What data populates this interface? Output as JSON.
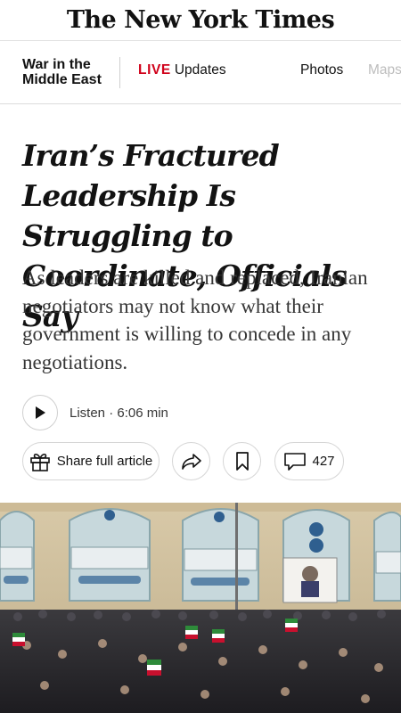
{
  "masthead": {
    "logo": "The New York Times"
  },
  "section_bar": {
    "section_title": "War in the Middle East",
    "live_label": "LIVE",
    "live_text": "Updates",
    "nav": [
      "Photos",
      "Maps"
    ]
  },
  "article": {
    "headline": "Iran’s Fractured Leadership Is Struggling to Coordinate, Officials Say",
    "summary": "As leaders are killed and replaced, Iranian negotiators may not know what their government is willing to concede in any negotiations."
  },
  "audio": {
    "listen_text": "Listen · 6:06 min",
    "play_icon": "play-icon"
  },
  "actions": {
    "share_label": "Share full article",
    "comment_count": "427",
    "icons": [
      "gift-icon",
      "share-arrow-icon",
      "bookmark-icon",
      "comment-icon"
    ]
  },
  "colors": {
    "live_red": "#d0021b",
    "text": "#121212",
    "border": "#d6d6d6"
  }
}
